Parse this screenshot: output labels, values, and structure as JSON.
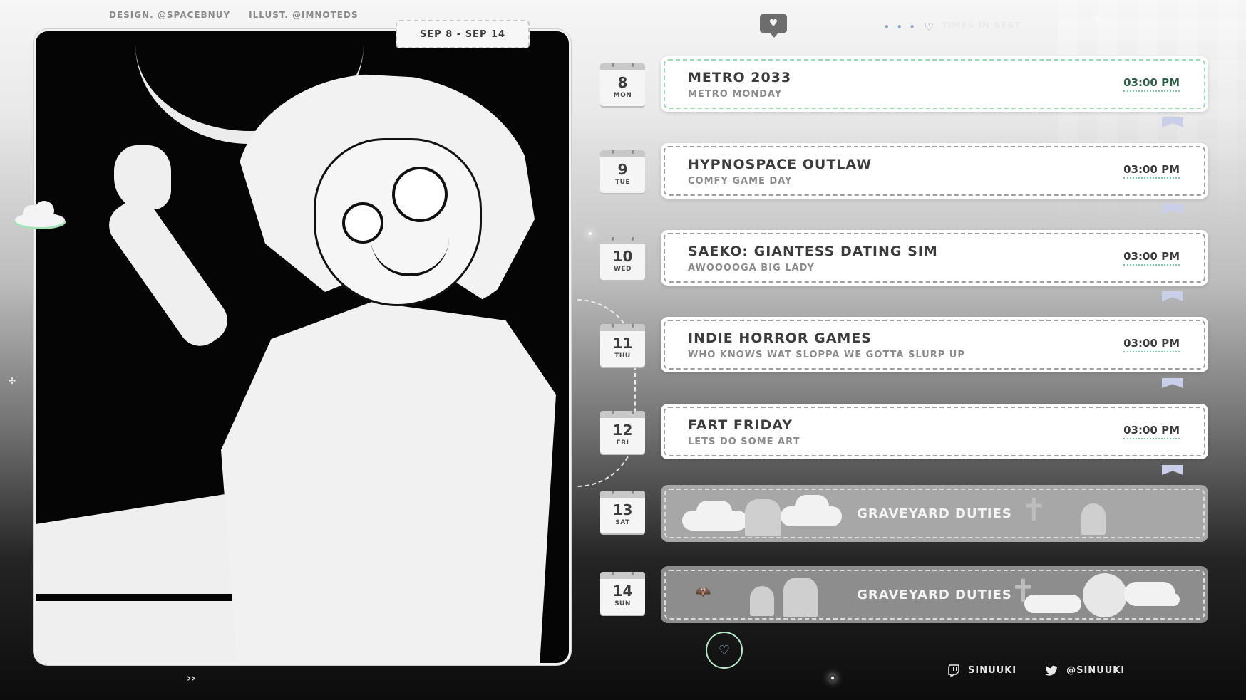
{
  "credits": {
    "design": "DESIGN. @SPACEBNUY",
    "illust": "ILLUST. @IMNOTEDS"
  },
  "date_range": "SEP 8 - SEP 14",
  "header": {
    "timezone_label": "TIMES IN AEST",
    "dots": "• • •"
  },
  "schedule": [
    {
      "day": "8",
      "dow": "MON",
      "title": "METRO 2033",
      "subtitle": "METRO MONDAY",
      "time": "03:00 PM"
    },
    {
      "day": "9",
      "dow": "TUE",
      "title": "HYPNOSPACE OUTLAW",
      "subtitle": "COMFY GAME DAY",
      "time": "03:00 PM"
    },
    {
      "day": "10",
      "dow": "WED",
      "title": "SAEKO: GIANTESS DATING SIM",
      "subtitle": "AWOOOOGA BIG LADY",
      "time": "03:00 PM"
    },
    {
      "day": "11",
      "dow": "THU",
      "title": "INDIE HORROR GAMES",
      "subtitle": "WHO KNOWS WAT SLOPPA WE GOTTA SLURP UP",
      "time": "03:00 PM"
    },
    {
      "day": "12",
      "dow": "FRI",
      "title": "FART FRIDAY",
      "subtitle": "LETS DO SOME ART",
      "time": "03:00 PM"
    }
  ],
  "off_days": [
    {
      "day": "13",
      "dow": "SAT",
      "label": "GRAVEYARD DUTIES"
    },
    {
      "day": "14",
      "dow": "SUN",
      "label": "GRAVEYARD DUTIES"
    }
  ],
  "footer": {
    "arrows": "››",
    "twitch_handle": "SINUUKI",
    "twitter_handle": "@SINUUKI"
  },
  "colors": {
    "accent_green": "#9fd9b5",
    "accent_blue": "#8ca1c9",
    "ribbon": "#c9cfe9"
  },
  "icons": [
    "heart-icon",
    "message-heart-icon",
    "twitch-icon",
    "twitter-icon",
    "cloud-icon",
    "sparkle-icon"
  ]
}
